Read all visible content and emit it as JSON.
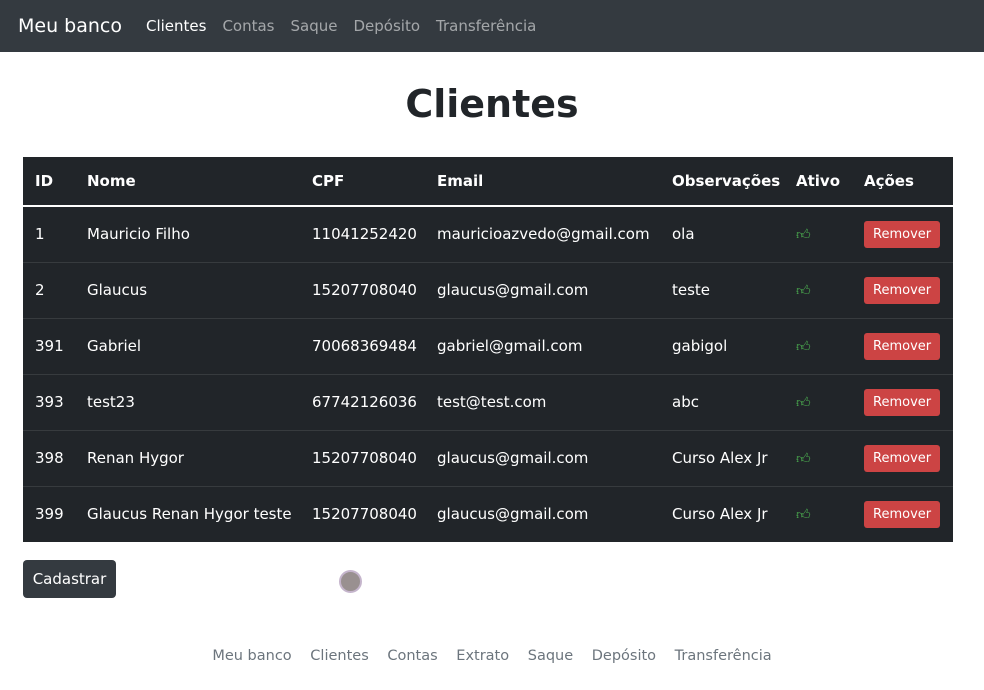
{
  "nav": {
    "brand": "Meu banco",
    "links": [
      "Clientes",
      "Contas",
      "Saque",
      "Depósito",
      "Transferência"
    ]
  },
  "title": "Clientes",
  "table": {
    "headers": [
      "ID",
      "Nome",
      "CPF",
      "Email",
      "Observações",
      "Ativo",
      "Ações"
    ],
    "rows": [
      {
        "id": "1",
        "nome": "Mauricio Filho",
        "cpf": "11041252420",
        "email": "mauricioazvedo@gmail.com",
        "obs": "ola",
        "action": "Remover"
      },
      {
        "id": "2",
        "nome": "Glaucus",
        "cpf": "15207708040",
        "email": "glaucus@gmail.com",
        "obs": "teste",
        "action": "Remover"
      },
      {
        "id": "391",
        "nome": "Gabriel",
        "cpf": "70068369484",
        "email": "gabriel@gmail.com",
        "obs": "gabigol",
        "action": "Remover"
      },
      {
        "id": "393",
        "nome": "test23",
        "cpf": "67742126036",
        "email": "test@test.com",
        "obs": "abc",
        "action": "Remover"
      },
      {
        "id": "398",
        "nome": "Renan Hygor",
        "cpf": "15207708040",
        "email": "glaucus@gmail.com",
        "obs": "Curso Alex Jr",
        "action": "Remover"
      },
      {
        "id": "399",
        "nome": "Glaucus Renan Hygor teste",
        "cpf": "15207708040",
        "email": "glaucus@gmail.com",
        "obs": "Curso Alex Jr",
        "action": "Remover"
      }
    ]
  },
  "cadastrar": "Cadastrar",
  "footer": [
    "Meu banco",
    "Clientes",
    "Contas",
    "Extrato",
    "Saque",
    "Depósito",
    "Transferência"
  ]
}
